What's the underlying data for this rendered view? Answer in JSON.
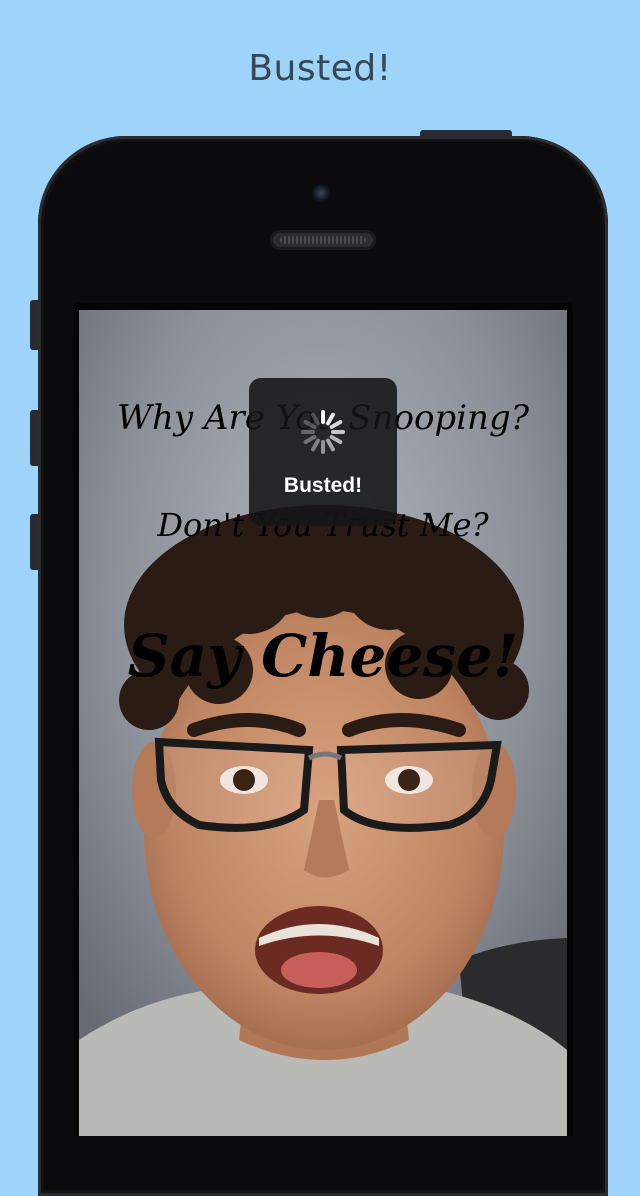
{
  "header": {
    "title": "Busted!"
  },
  "screen": {
    "overlay": {
      "line1": "Why Are You Snooping?",
      "line2": "Don't You Trust Me?",
      "line3": "Say Cheese!"
    },
    "hud": {
      "label": "Busted!",
      "icon": "activity-spinner-icon"
    }
  },
  "colors": {
    "background": "#9ed3fa",
    "title_text": "#3a4653",
    "phone_body": "#0b0b0d",
    "hud_bg": "#141416"
  }
}
